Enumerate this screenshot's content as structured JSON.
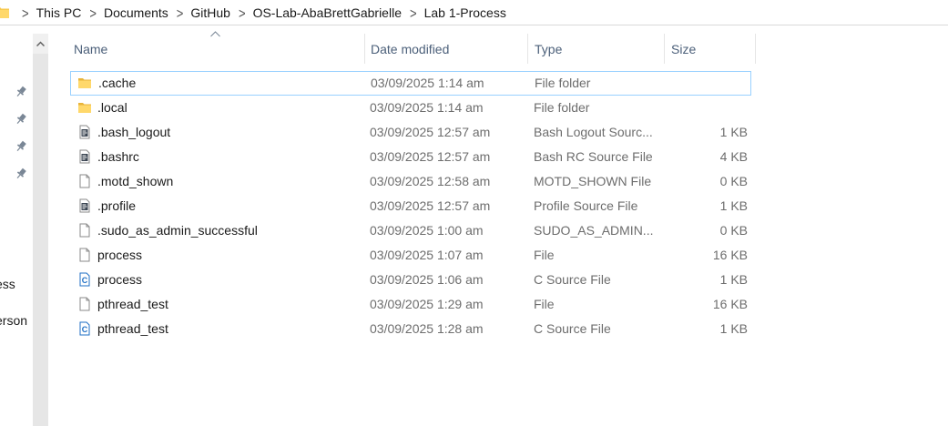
{
  "breadcrumb": {
    "items": [
      "This PC",
      "Documents",
      "GitHub",
      "OS-Lab-AbaBrettGabrielle",
      "Lab 1-Process"
    ]
  },
  "nav": {
    "pinned_count": 4,
    "partial_labels": [
      "ess",
      "erson"
    ]
  },
  "columns": {
    "name": "Name",
    "date_modified": "Date modified",
    "type": "Type",
    "size": "Size"
  },
  "colors": {
    "folder": "#f8c94c",
    "selection_border": "#99d1ff",
    "header_text": "#4c607a",
    "detail_text": "#6d6d6d",
    "c_file_accent": "#1f6fc4"
  },
  "files": [
    {
      "name": ".cache",
      "date": "03/09/2025 1:14 am",
      "type": "File folder",
      "size": "",
      "icon": "folder-icon",
      "selected": true
    },
    {
      "name": ".local",
      "date": "03/09/2025 1:14 am",
      "type": "File folder",
      "size": "",
      "icon": "folder-icon"
    },
    {
      "name": ".bash_logout",
      "date": "03/09/2025 12:57 am",
      "type": "Bash Logout Sourc...",
      "size": "1 KB",
      "icon": "script-file-icon"
    },
    {
      "name": ".bashrc",
      "date": "03/09/2025 12:57 am",
      "type": "Bash RC Source File",
      "size": "4 KB",
      "icon": "script-file-icon"
    },
    {
      "name": ".motd_shown",
      "date": "03/09/2025 12:58 am",
      "type": "MOTD_SHOWN File",
      "size": "0 KB",
      "icon": "blank-file-icon"
    },
    {
      "name": ".profile",
      "date": "03/09/2025 12:57 am",
      "type": "Profile Source File",
      "size": "1 KB",
      "icon": "script-file-icon"
    },
    {
      "name": ".sudo_as_admin_successful",
      "date": "03/09/2025 1:00 am",
      "type": "SUDO_AS_ADMIN...",
      "size": "0 KB",
      "icon": "blank-file-icon"
    },
    {
      "name": "process",
      "date": "03/09/2025 1:07 am",
      "type": "File",
      "size": "16 KB",
      "icon": "blank-file-icon"
    },
    {
      "name": "process",
      "date": "03/09/2025 1:06 am",
      "type": "C Source File",
      "size": "1 KB",
      "icon": "c-file-icon"
    },
    {
      "name": "pthread_test",
      "date": "03/09/2025 1:29 am",
      "type": "File",
      "size": "16 KB",
      "icon": "blank-file-icon"
    },
    {
      "name": "pthread_test",
      "date": "03/09/2025 1:28 am",
      "type": "C Source File",
      "size": "1 KB",
      "icon": "c-file-icon"
    }
  ]
}
